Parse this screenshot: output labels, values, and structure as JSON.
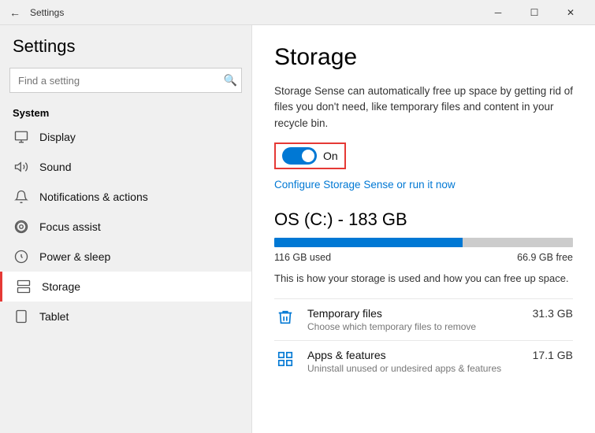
{
  "titlebar": {
    "back_label": "←",
    "title": "Settings",
    "minimize_label": "─",
    "maximize_label": "☐",
    "close_label": "✕"
  },
  "sidebar": {
    "header": "Settings",
    "search_placeholder": "Find a setting",
    "search_icon": "🔍",
    "section_label": "System",
    "items": [
      {
        "id": "display",
        "label": "Display",
        "icon": "🖥"
      },
      {
        "id": "sound",
        "label": "Sound",
        "icon": "🔊"
      },
      {
        "id": "notifications",
        "label": "Notifications & actions",
        "icon": "💬"
      },
      {
        "id": "focus-assist",
        "label": "Focus assist",
        "icon": "🌙"
      },
      {
        "id": "power-sleep",
        "label": "Power & sleep",
        "icon": "⏻"
      },
      {
        "id": "storage",
        "label": "Storage",
        "icon": "💾",
        "active": true
      },
      {
        "id": "tablet",
        "label": "Tablet",
        "icon": "⊞"
      }
    ]
  },
  "content": {
    "title": "Storage",
    "storage_sense_desc": "Storage Sense can automatically free up space by getting rid of files you don't need, like temporary files and content in your recycle bin.",
    "toggle_state": "On",
    "configure_link": "Configure Storage Sense or run it now",
    "drive_title": "OS (C:) - 183 GB",
    "used_label": "116 GB used",
    "free_label": "66.9 GB free",
    "used_percent": 63,
    "storage_detail_desc": "This is how your storage is used and how you can free up space.",
    "storage_items": [
      {
        "name": "Temporary files",
        "sub": "Choose which temporary files to remove",
        "size": "31.3 GB",
        "icon": "🗑"
      },
      {
        "name": "Apps & features",
        "sub": "Uninstall unused or undesired apps & features",
        "size": "17.1 GB",
        "icon": "▦"
      }
    ]
  }
}
